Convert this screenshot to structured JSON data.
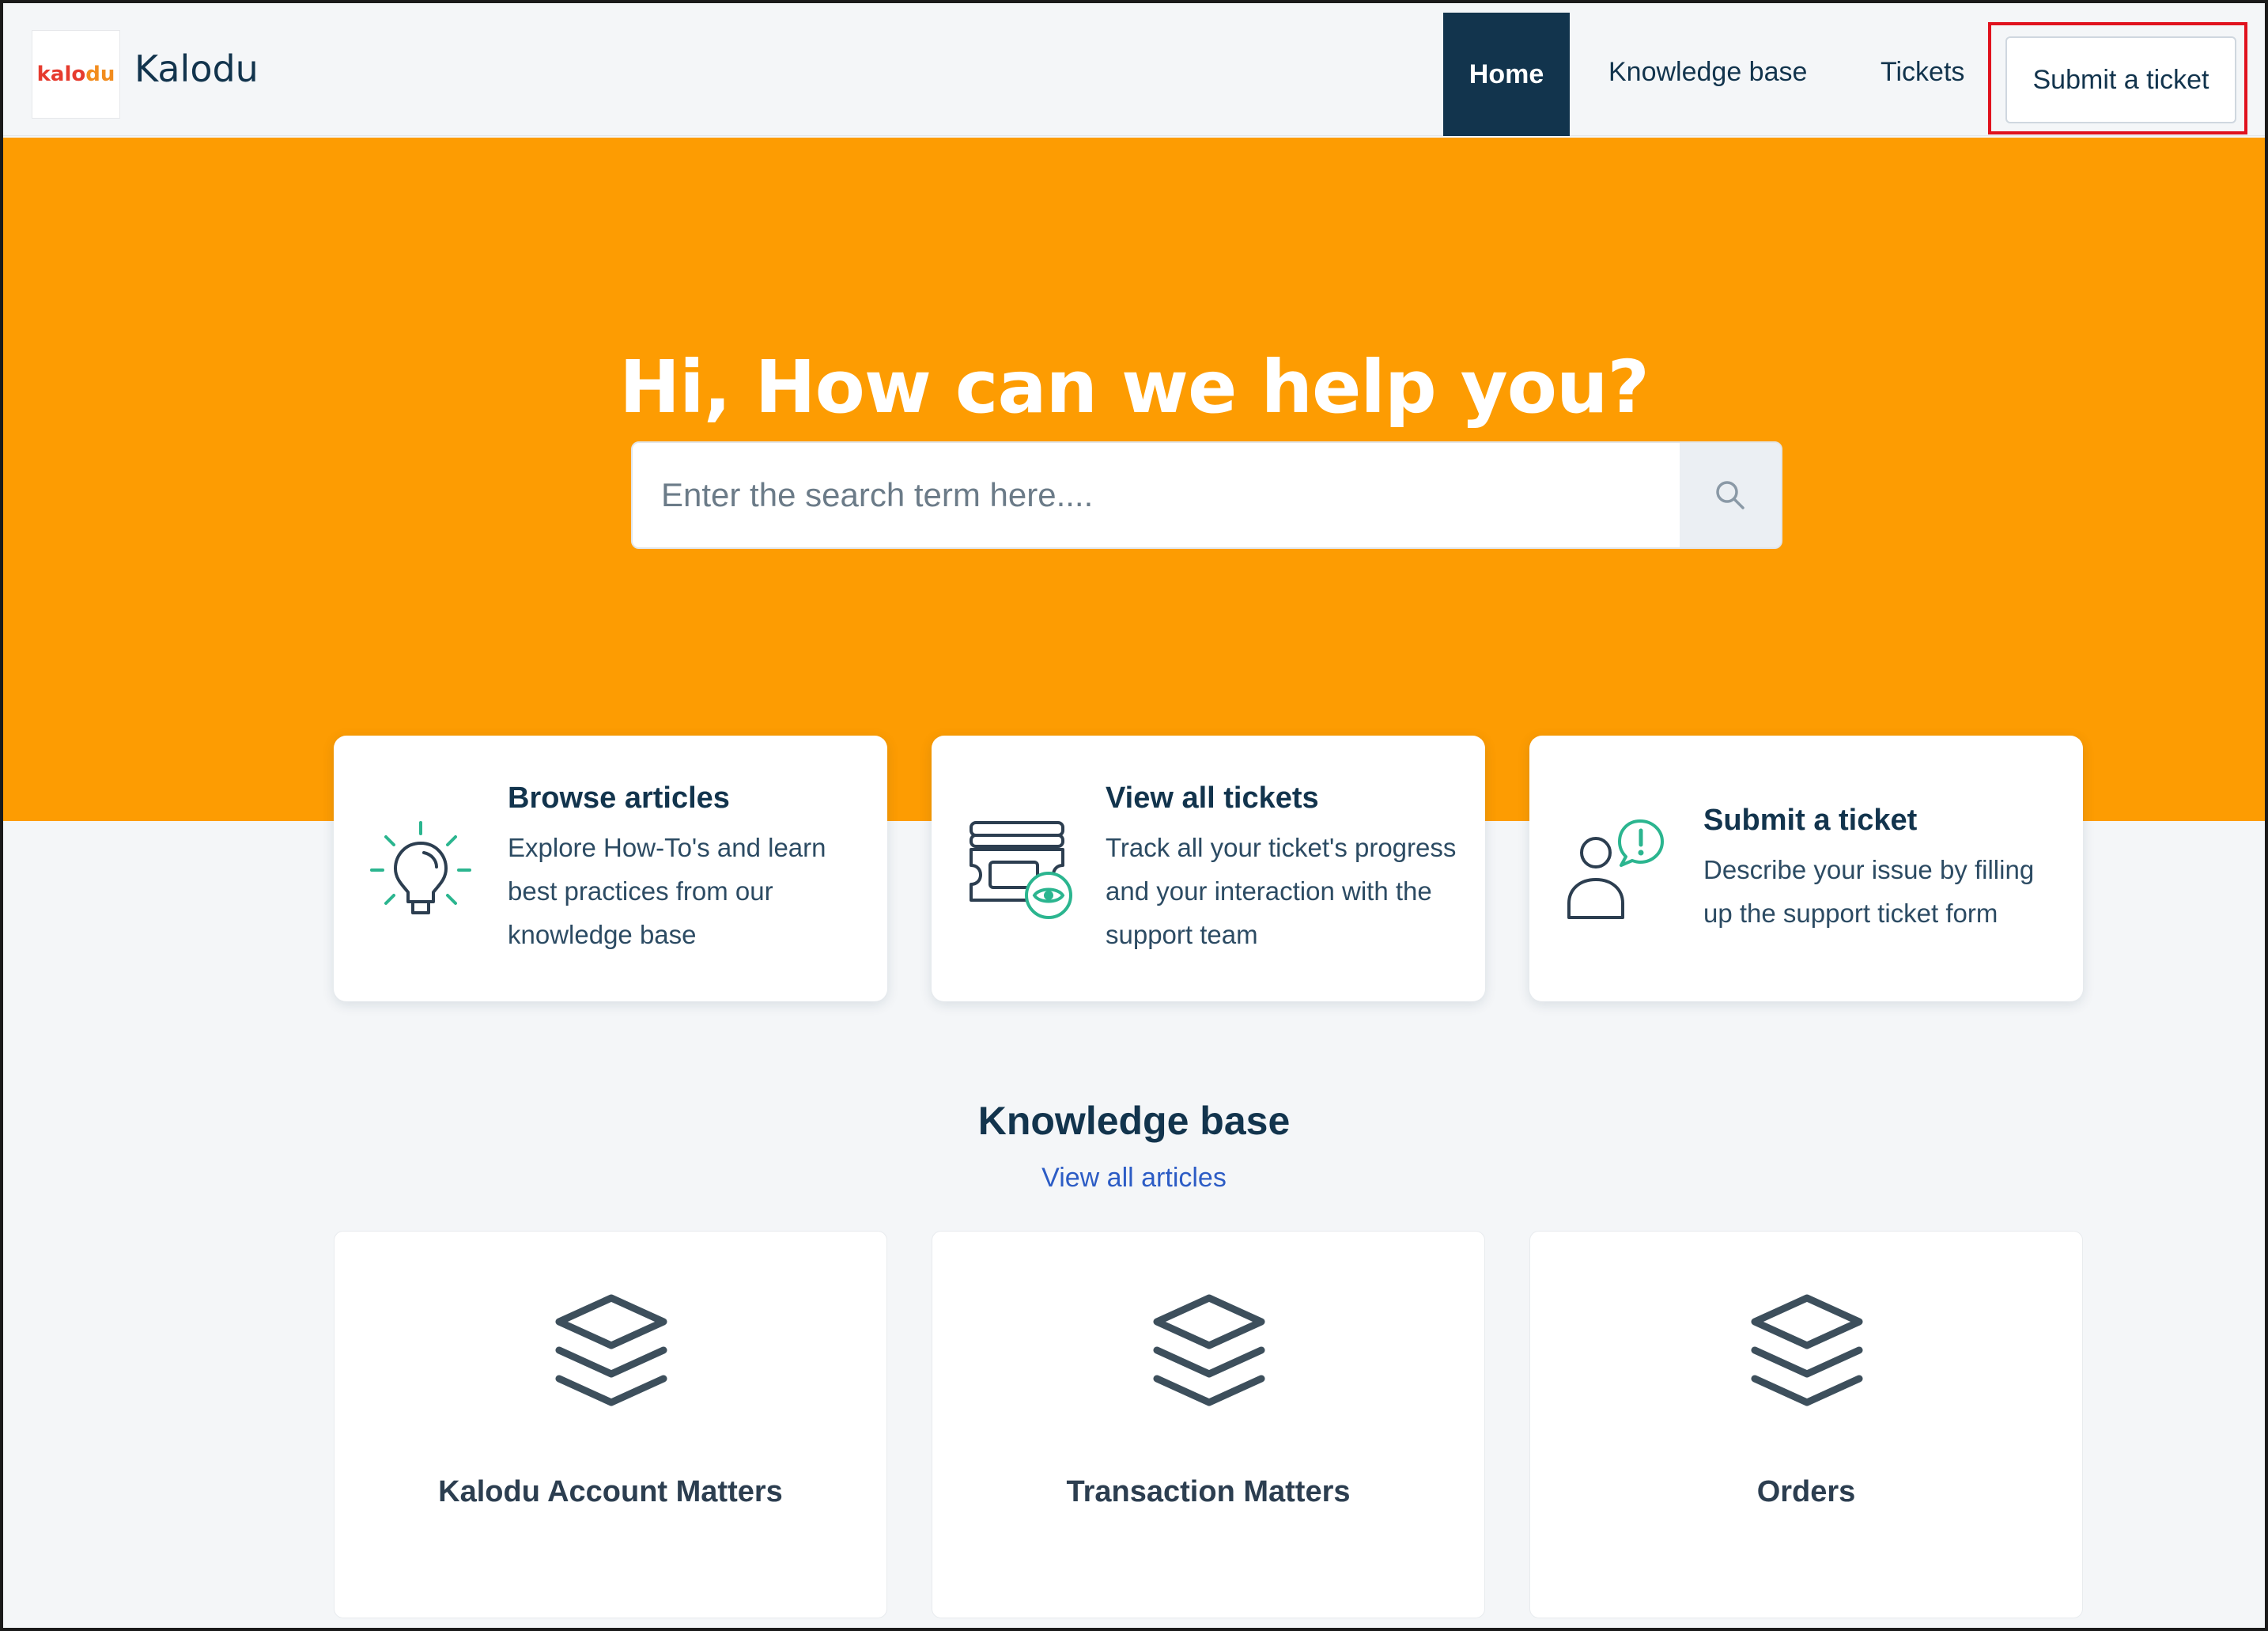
{
  "header": {
    "logo_text": "kalodu",
    "brand_name": "Kalodu",
    "nav": {
      "home": "Home",
      "knowledge_base": "Knowledge base",
      "tickets": "Tickets",
      "submit_ticket": "Submit a ticket"
    }
  },
  "hero": {
    "title": "Hi, How can we help you?",
    "search_placeholder": "Enter the search term here....",
    "search_icon": "search-icon"
  },
  "features": [
    {
      "title": "Browse articles",
      "description": "Explore How-To's and learn best practices from our knowledge base",
      "icon": "lightbulb-icon"
    },
    {
      "title": "View all tickets",
      "description": "Track all your ticket's progress and your interaction with the support team",
      "icon": "tickets-eye-icon"
    },
    {
      "title": "Submit a ticket",
      "description": "Describe your issue by filling up the support ticket form",
      "icon": "person-alert-icon"
    }
  ],
  "knowledge_base": {
    "title": "Knowledge base",
    "view_all": "View all articles",
    "categories": [
      {
        "label": "Kalodu Account Matters",
        "icon": "layers-icon"
      },
      {
        "label": "Transaction Matters",
        "icon": "layers-icon"
      },
      {
        "label": "Orders",
        "icon": "layers-icon"
      }
    ]
  },
  "colors": {
    "hero_orange": "#fd9c02",
    "navy": "#12344d",
    "accent_green": "#2bb58f",
    "link_blue": "#2c5cc5",
    "highlight_red": "#e0121e"
  }
}
